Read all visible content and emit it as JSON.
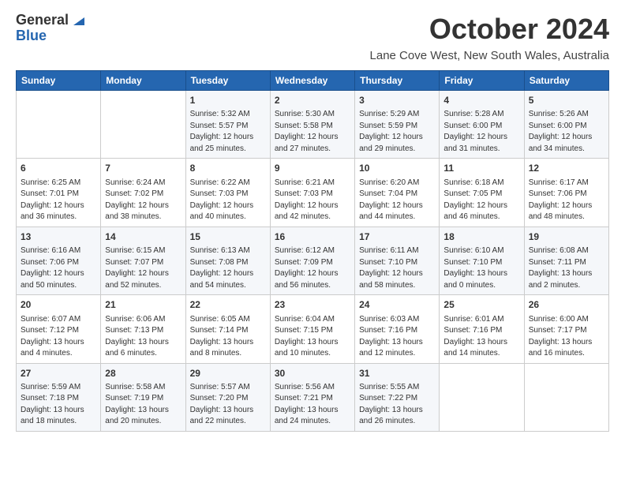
{
  "logo": {
    "line1": "General",
    "line2": "Blue"
  },
  "title": "October 2024",
  "subtitle": "Lane Cove West, New South Wales, Australia",
  "days_of_week": [
    "Sunday",
    "Monday",
    "Tuesday",
    "Wednesday",
    "Thursday",
    "Friday",
    "Saturday"
  ],
  "weeks": [
    [
      {
        "day": "",
        "info": ""
      },
      {
        "day": "",
        "info": ""
      },
      {
        "day": "1",
        "info": "Sunrise: 5:32 AM\nSunset: 5:57 PM\nDaylight: 12 hours\nand 25 minutes."
      },
      {
        "day": "2",
        "info": "Sunrise: 5:30 AM\nSunset: 5:58 PM\nDaylight: 12 hours\nand 27 minutes."
      },
      {
        "day": "3",
        "info": "Sunrise: 5:29 AM\nSunset: 5:59 PM\nDaylight: 12 hours\nand 29 minutes."
      },
      {
        "day": "4",
        "info": "Sunrise: 5:28 AM\nSunset: 6:00 PM\nDaylight: 12 hours\nand 31 minutes."
      },
      {
        "day": "5",
        "info": "Sunrise: 5:26 AM\nSunset: 6:00 PM\nDaylight: 12 hours\nand 34 minutes."
      }
    ],
    [
      {
        "day": "6",
        "info": "Sunrise: 6:25 AM\nSunset: 7:01 PM\nDaylight: 12 hours\nand 36 minutes."
      },
      {
        "day": "7",
        "info": "Sunrise: 6:24 AM\nSunset: 7:02 PM\nDaylight: 12 hours\nand 38 minutes."
      },
      {
        "day": "8",
        "info": "Sunrise: 6:22 AM\nSunset: 7:03 PM\nDaylight: 12 hours\nand 40 minutes."
      },
      {
        "day": "9",
        "info": "Sunrise: 6:21 AM\nSunset: 7:03 PM\nDaylight: 12 hours\nand 42 minutes."
      },
      {
        "day": "10",
        "info": "Sunrise: 6:20 AM\nSunset: 7:04 PM\nDaylight: 12 hours\nand 44 minutes."
      },
      {
        "day": "11",
        "info": "Sunrise: 6:18 AM\nSunset: 7:05 PM\nDaylight: 12 hours\nand 46 minutes."
      },
      {
        "day": "12",
        "info": "Sunrise: 6:17 AM\nSunset: 7:06 PM\nDaylight: 12 hours\nand 48 minutes."
      }
    ],
    [
      {
        "day": "13",
        "info": "Sunrise: 6:16 AM\nSunset: 7:06 PM\nDaylight: 12 hours\nand 50 minutes."
      },
      {
        "day": "14",
        "info": "Sunrise: 6:15 AM\nSunset: 7:07 PM\nDaylight: 12 hours\nand 52 minutes."
      },
      {
        "day": "15",
        "info": "Sunrise: 6:13 AM\nSunset: 7:08 PM\nDaylight: 12 hours\nand 54 minutes."
      },
      {
        "day": "16",
        "info": "Sunrise: 6:12 AM\nSunset: 7:09 PM\nDaylight: 12 hours\nand 56 minutes."
      },
      {
        "day": "17",
        "info": "Sunrise: 6:11 AM\nSunset: 7:10 PM\nDaylight: 12 hours\nand 58 minutes."
      },
      {
        "day": "18",
        "info": "Sunrise: 6:10 AM\nSunset: 7:10 PM\nDaylight: 13 hours\nand 0 minutes."
      },
      {
        "day": "19",
        "info": "Sunrise: 6:08 AM\nSunset: 7:11 PM\nDaylight: 13 hours\nand 2 minutes."
      }
    ],
    [
      {
        "day": "20",
        "info": "Sunrise: 6:07 AM\nSunset: 7:12 PM\nDaylight: 13 hours\nand 4 minutes."
      },
      {
        "day": "21",
        "info": "Sunrise: 6:06 AM\nSunset: 7:13 PM\nDaylight: 13 hours\nand 6 minutes."
      },
      {
        "day": "22",
        "info": "Sunrise: 6:05 AM\nSunset: 7:14 PM\nDaylight: 13 hours\nand 8 minutes."
      },
      {
        "day": "23",
        "info": "Sunrise: 6:04 AM\nSunset: 7:15 PM\nDaylight: 13 hours\nand 10 minutes."
      },
      {
        "day": "24",
        "info": "Sunrise: 6:03 AM\nSunset: 7:16 PM\nDaylight: 13 hours\nand 12 minutes."
      },
      {
        "day": "25",
        "info": "Sunrise: 6:01 AM\nSunset: 7:16 PM\nDaylight: 13 hours\nand 14 minutes."
      },
      {
        "day": "26",
        "info": "Sunrise: 6:00 AM\nSunset: 7:17 PM\nDaylight: 13 hours\nand 16 minutes."
      }
    ],
    [
      {
        "day": "27",
        "info": "Sunrise: 5:59 AM\nSunset: 7:18 PM\nDaylight: 13 hours\nand 18 minutes."
      },
      {
        "day": "28",
        "info": "Sunrise: 5:58 AM\nSunset: 7:19 PM\nDaylight: 13 hours\nand 20 minutes."
      },
      {
        "day": "29",
        "info": "Sunrise: 5:57 AM\nSunset: 7:20 PM\nDaylight: 13 hours\nand 22 minutes."
      },
      {
        "day": "30",
        "info": "Sunrise: 5:56 AM\nSunset: 7:21 PM\nDaylight: 13 hours\nand 24 minutes."
      },
      {
        "day": "31",
        "info": "Sunrise: 5:55 AM\nSunset: 7:22 PM\nDaylight: 13 hours\nand 26 minutes."
      },
      {
        "day": "",
        "info": ""
      },
      {
        "day": "",
        "info": ""
      }
    ]
  ]
}
